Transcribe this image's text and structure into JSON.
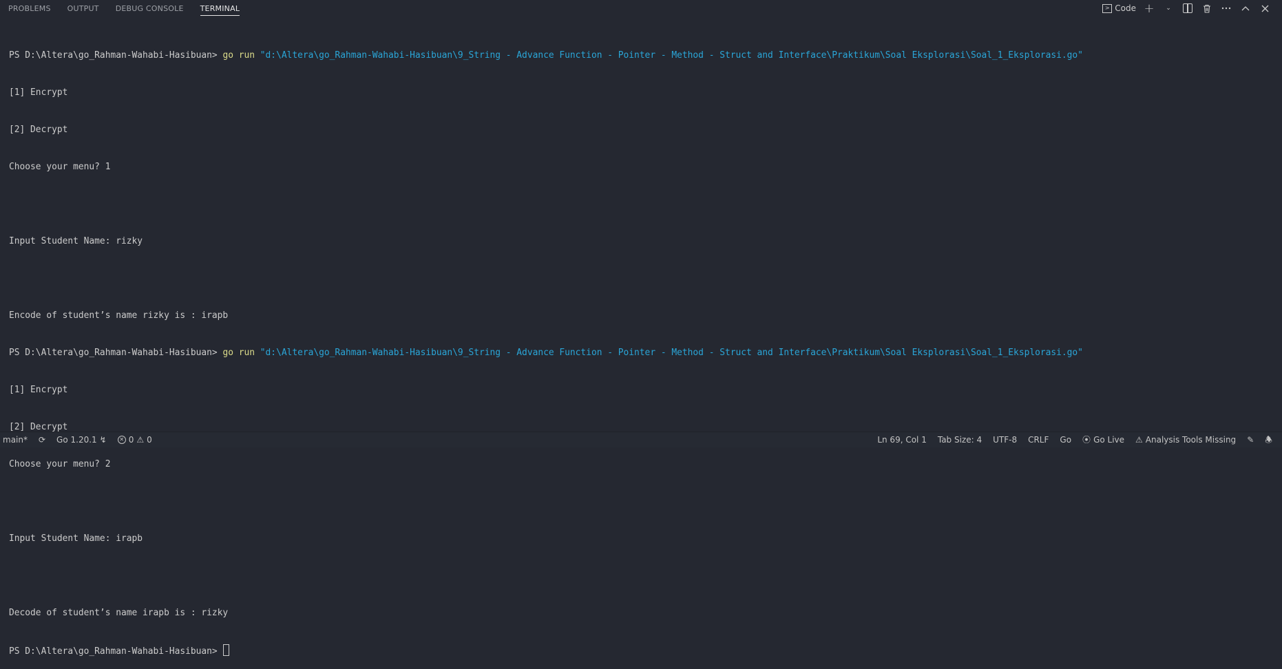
{
  "panel": {
    "tabs": [
      {
        "label": "PROBLEMS"
      },
      {
        "label": "OUTPUT"
      },
      {
        "label": "DEBUG CONSOLE"
      },
      {
        "label": "TERMINAL"
      }
    ],
    "terminal_select_label": "Code",
    "icons": [
      "terminal-icon",
      "plus-icon",
      "chevron-down-icon",
      "split-icon",
      "trash-icon",
      "more-icon",
      "chevron-up-icon",
      "close-icon"
    ]
  },
  "terminal": {
    "prompt": "PS D:\\Altera\\go_Rahman-Wahabi-Hasibuan> ",
    "command_keyword": "go run",
    "command_path": "\"d:\\Altera\\go_Rahman-Wahabi-Hasibuan\\9_String - Advance Function - Pointer - Method - Struct and Interface\\Praktikum\\Soal Eksplorasi\\Soal_1_Eksplorasi.go\"",
    "run1": {
      "menu1": "[1] Encrypt",
      "menu2": "[2] Decrypt",
      "choose": "Choose your menu? 1",
      "blank1": "",
      "input": "Input Student Name: rizky",
      "blank2": "",
      "result": "Encode of student’s name rizky is : irapb"
    },
    "run2": {
      "menu1": "[1] Encrypt",
      "menu2": "[2] Decrypt",
      "choose": "Choose your menu? 2",
      "blank1": "",
      "input": "Input Student Name: irapb",
      "blank2": "",
      "result": "Decode of student’s name irapb is : rizky"
    },
    "final_prompt": "PS D:\\Altera\\go_Rahman-Wahabi-Hasibuan> "
  },
  "statusbar": {
    "branch": "main*",
    "go_version": "Go 1.20.1",
    "errors": "0",
    "warnings": "0",
    "position": "Ln 69, Col 1",
    "tab_size": "Tab Size: 4",
    "encoding": "UTF-8",
    "eol": "CRLF",
    "language": "Go",
    "go_live": "Go Live",
    "analysis": "Analysis Tools Missing"
  },
  "colors": {
    "background": "#252831",
    "command": "#dcdc8b",
    "string": "#2aa6d8"
  }
}
